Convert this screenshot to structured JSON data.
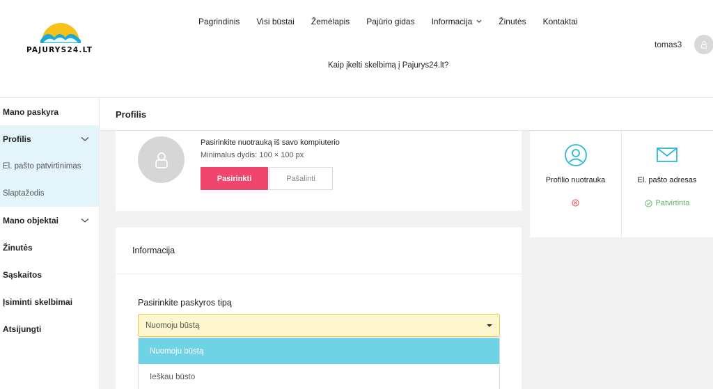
{
  "logo": {
    "text": "PAJURYS24.LT",
    "sun_color": "#f6c21a",
    "wave_color": "#1ba9d6"
  },
  "nav": {
    "items": [
      {
        "label": "Pagrindinis"
      },
      {
        "label": "Visi būstai"
      },
      {
        "label": "Žemėlapis"
      },
      {
        "label": "Pajūrio gidas"
      },
      {
        "label": "Informacija"
      },
      {
        "label": "Žinutės"
      },
      {
        "label": "Kontaktai"
      }
    ],
    "sub_link": "Kaip įkelti skelbimą į Pajurys24.lt?"
  },
  "user": {
    "name": "tomas3"
  },
  "sidebar": {
    "items": [
      {
        "label": "Mano paskyra"
      },
      {
        "label": "Profilis"
      },
      {
        "label": "El. pašto patvirtinimas"
      },
      {
        "label": "Slaptažodis"
      },
      {
        "label": "Mano objektai"
      },
      {
        "label": "Žinutės"
      },
      {
        "label": "Sąskaitos"
      },
      {
        "label": "Įsiminti skelbimai"
      },
      {
        "label": "Atsijungti"
      }
    ]
  },
  "main": {
    "title": "Profilis",
    "photo": {
      "title": "Pasirinkite nuotrauką iš savo kompiuterio",
      "min_size": "Minimalus dydis: 100 × 100 px",
      "choose_label": "Pasirinkti",
      "remove_label": "Pašalinti"
    },
    "status": {
      "photo_label": "Profilio nuotrauka",
      "email_label": "El. pašto adresas",
      "email_state": "Patvirtinta"
    },
    "info": {
      "title": "Informacija",
      "account_type_label": "Pasirinkite paskyros tipą",
      "selected_value": "Nuomoju būstą",
      "options": [
        {
          "label": "Nuomoju būstą"
        },
        {
          "label": "Ieškau būsto"
        }
      ]
    }
  },
  "colors": {
    "accent_pink": "#f0456c",
    "accent_cyan": "#2ab8d4",
    "success_green": "#5cb85c",
    "error_red": "#e25050",
    "dropdown_highlight": "#6fd3e6",
    "select_bg": "#fdf6cf",
    "sidebar_active": "#e3f4fa"
  }
}
